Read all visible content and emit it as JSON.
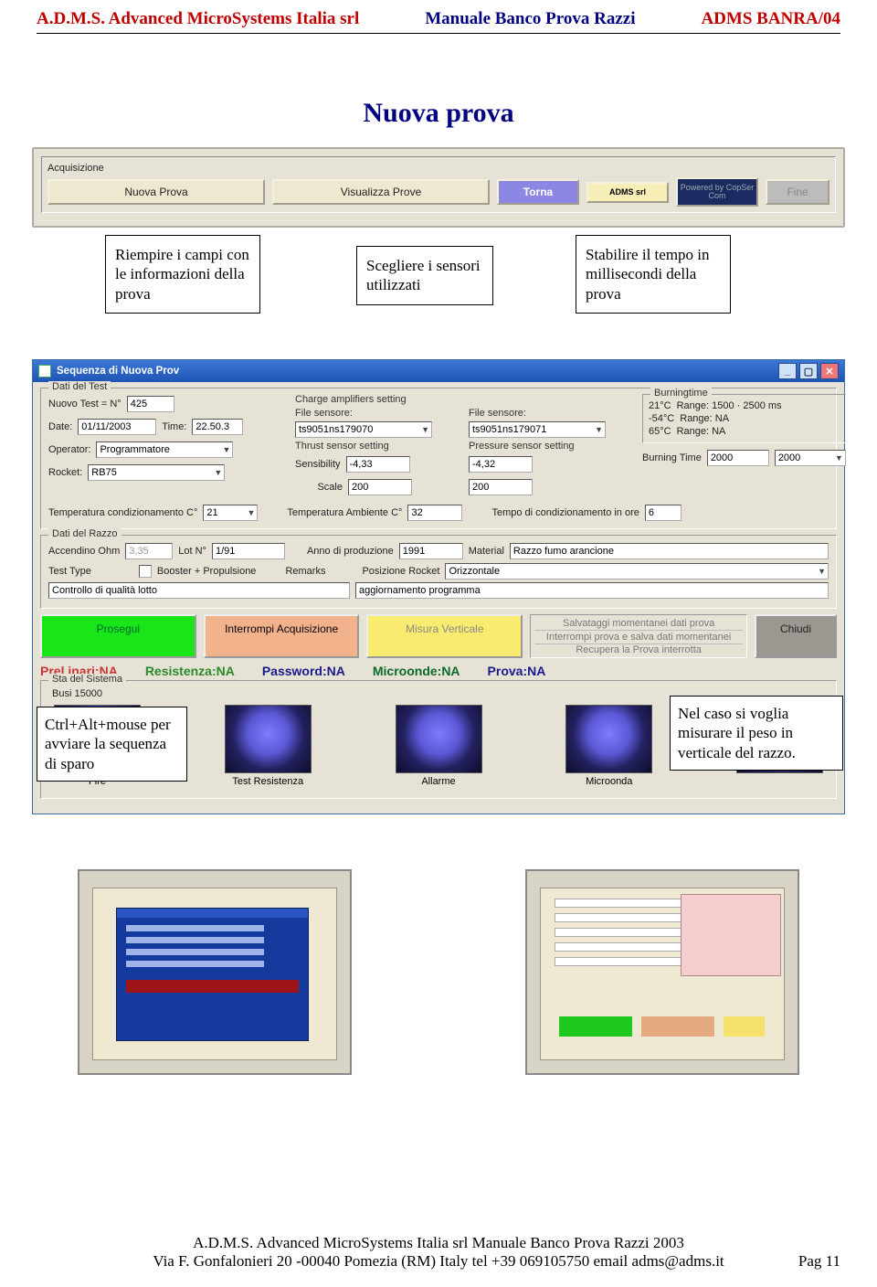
{
  "header": {
    "left": "A.D.M.S. Advanced MicroSystems Italia srl",
    "mid": "Manuale Banco Prova Razzi",
    "right": "ADMS BANRA/04"
  },
  "title": "Nuova prova",
  "acq": {
    "legend": "Acquisizione",
    "nuova": "Nuova Prova",
    "visualizza": "Visualizza Prove",
    "torna": "Torna",
    "adms": "ADMS srl",
    "powered": "Powered by CopSer Com",
    "fine": "Fine"
  },
  "callouts": {
    "c1": "Riempire i campi con le informazioni della prova",
    "c2": "Scegliere i sensori utilizzati",
    "c3": "Stabilire il tempo in millisecondi della prova",
    "c4": "Ctrl+Alt+mouse per avviare la sequenza di sparo",
    "c5": "Nel caso si voglia misurare il peso in verticale del razzo."
  },
  "dlg": {
    "title": "Sequenza di Nuova Prov",
    "groups": {
      "test": "Dati del Test",
      "razzo": "Dati del Razzo",
      "sistema": "Sta   del Sistema"
    },
    "labels": {
      "nuovoTest": "Nuovo Test = N°",
      "date": "Date:",
      "time": "Time:",
      "operator": "Operator:",
      "rocket": "Rocket:",
      "chargeAmp": "Charge amplifiers setting",
      "fileSensore": "File sensore:",
      "thrustSetting": "Thrust sensor setting",
      "pressureSetting": "Pressure sensor setting",
      "sensibility": "Sensibility",
      "scale": "Scale",
      "burningtime": "Burningtime",
      "t21": "21°C",
      "tm54": "-54°C",
      "t65": "65°C",
      "r1": "Range: 1500 · 2500 ms",
      "rNA": "Range: NA",
      "burningTime": "Burning Time",
      "tempCond": "Temperatura  condizionamento C°",
      "tempAmb": "Temperatura Ambiente C°",
      "tempOre": "Tempo di condizionamento  in ore",
      "accendino": "Accendino  Ohm",
      "lot": "Lot N°",
      "anno": "Anno di produzione",
      "material": "Material",
      "testtype": "Test Type",
      "booster": "Booster + Propulsione",
      "remarks": "Remarks",
      "posRocket": "Posizione Rocket",
      "saveHeader": "Salvataggi momentanei dati prova",
      "saveL1": "Interrompi prova e salva dati momentanei",
      "saveL2": "Recupera la Prova interrotta",
      "busi": "Busi     15000"
    },
    "values": {
      "nuovoTest": "425",
      "date": "01/11/2003",
      "time": "22.50.3",
      "operator": "Programmatore",
      "rocket": "RB75",
      "fileSensore1": "ts9051ns179070",
      "fileSensore2": "ts9051ns179071",
      "sens1": "-4,33",
      "sens2": "-4,32",
      "scale1": "200",
      "scale2": "200",
      "burn1": "2000",
      "burn2": "2000",
      "tempCond": "21",
      "tempAmb": "32",
      "tempOre": "6",
      "accendino": "3,35",
      "lot": "1/91",
      "anno": "1991",
      "material": "Razzo fumo arancione",
      "posRocket": "Orizzontale",
      "testtype": "Controllo di qualità lotto",
      "remarks": "aggiornamento programma"
    },
    "actions": {
      "prosegui": "Prosegui",
      "interrompi": "Interrompi Acquisizione",
      "misura": "Misura Verticale",
      "chiudi": "Chiudi"
    },
    "status": {
      "s1": "Prel    inari:NA",
      "s2": "Resistenza:NA",
      "s3": "Password:NA",
      "s4": "Microonde:NA",
      "s5": "Prova:NA"
    },
    "bulbs": [
      "Fire",
      "Test Resistenza",
      "Allarme",
      "Microonda"
    ]
  },
  "footer": {
    "l1": "A.D.M.S. Advanced MicroSystems Italia srl     Manuale Banco Prova Razzi 2003",
    "l2": "Via F. Gonfalonieri 20 -00040 Pomezia (RM) Italy  tel +39 069105750 email adms@adms.it",
    "page": "Pag  11"
  }
}
